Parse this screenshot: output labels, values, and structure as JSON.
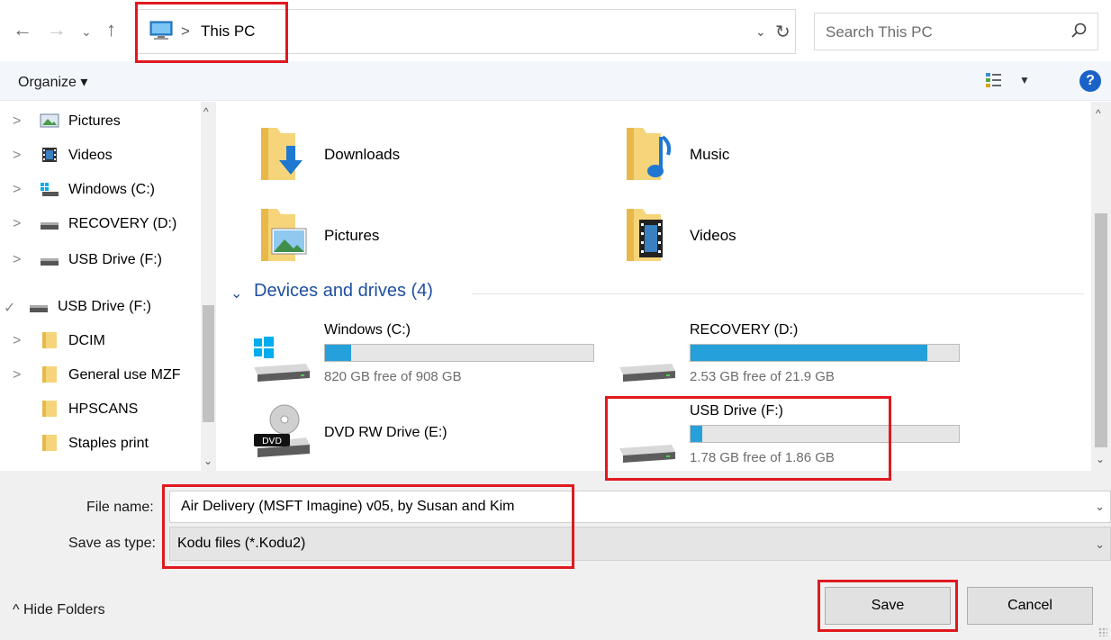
{
  "address_bar": {
    "breadcrumb_sep": ">",
    "location": "This PC",
    "refresh_glyph": "↻",
    "dropdown_glyph": "⌄"
  },
  "search": {
    "placeholder": "Search This PC"
  },
  "toolbar": {
    "organize_label": "Organize ▾",
    "help_label": "?"
  },
  "nav_pane": {
    "items": [
      {
        "label": "Pictures",
        "icon": "pictures-icon",
        "expand": ">"
      },
      {
        "label": "Videos",
        "icon": "videos-icon",
        "expand": ">"
      },
      {
        "label": "Windows (C:)",
        "icon": "windows-drive-icon",
        "expand": ">"
      },
      {
        "label": "RECOVERY (D:)",
        "icon": "drive-icon",
        "expand": ">"
      },
      {
        "label": "USB Drive (F:)",
        "icon": "usb-drive-icon",
        "expand": ">"
      },
      {
        "label": "USB Drive (F:)",
        "icon": "usb-drive-icon",
        "expand": "✓"
      },
      {
        "label": "DCIM",
        "icon": "folder-icon",
        "expand": ">"
      },
      {
        "label": "General use MZF",
        "icon": "folder-icon",
        "expand": ">"
      },
      {
        "label": "HPSCANS",
        "icon": "folder-icon",
        "expand": ""
      },
      {
        "label": "Staples print",
        "icon": "folder-icon",
        "expand": ""
      }
    ]
  },
  "content": {
    "folders": [
      {
        "label": "Downloads",
        "icon": "downloads-folder-icon"
      },
      {
        "label": "Music",
        "icon": "music-folder-icon"
      },
      {
        "label": "Pictures",
        "icon": "pictures-folder-icon"
      },
      {
        "label": "Videos",
        "icon": "videos-folder-icon"
      }
    ],
    "devices_group_label": "Devices and drives (4)",
    "drives": [
      {
        "name": "Windows (C:)",
        "free_text": "820 GB free of 908 GB",
        "used_fraction": 0.097,
        "icon": "windows-drive-icon"
      },
      {
        "name": "RECOVERY (D:)",
        "free_text": "2.53 GB free of 21.9 GB",
        "used_fraction": 0.884,
        "icon": "hard-drive-icon"
      },
      {
        "name": "DVD RW Drive (E:)",
        "free_text": "",
        "used_fraction": null,
        "icon": "dvd-drive-icon"
      },
      {
        "name": "USB Drive (F:)",
        "free_text": "1.78 GB free of 1.86 GB",
        "used_fraction": 0.043,
        "icon": "usb-drive-icon"
      }
    ]
  },
  "form": {
    "file_name_label": "File name:",
    "file_name_value": "Air Delivery (MSFT Imagine) v05, by Susan and Kim",
    "save_type_label": "Save as type:",
    "save_type_value": "Kodu files (*.Kodu2)"
  },
  "footer": {
    "hide_folders_label": "^  Hide Folders",
    "save_label": "Save",
    "cancel_label": "Cancel"
  },
  "colors": {
    "highlight": "#e0191f",
    "accent": "#1e4f9e",
    "progress": "#26a0da"
  }
}
